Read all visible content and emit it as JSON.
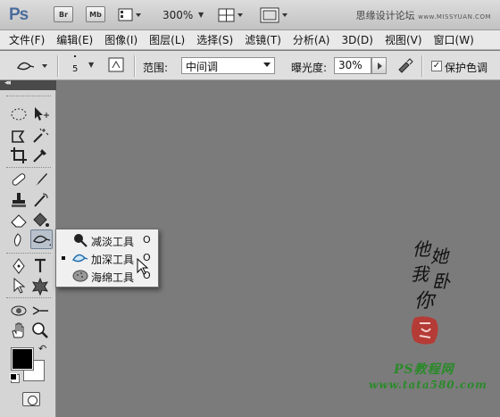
{
  "app": {
    "logo": "Ps",
    "bridge_label": "Br",
    "minibridge_label": "Mb",
    "zoom": "300%",
    "top_watermark": "思缘设计论坛",
    "top_watermark_url": "www.MISSYUAN.COM"
  },
  "menu": {
    "items": [
      "文件(F)",
      "编辑(E)",
      "图像(I)",
      "图层(L)",
      "选择(S)",
      "滤镜(T)",
      "分析(A)",
      "3D(D)",
      "视图(V)",
      "窗口(W)"
    ]
  },
  "options": {
    "brush_size": "5",
    "range_label": "范围:",
    "range_value": "中间调",
    "exposure_label": "曝光度:",
    "exposure_value": "30%",
    "protect_tones_label": "保护色调",
    "protect_tones_checked": true
  },
  "toolbar": {
    "collapse_glyph": "◂◂",
    "swap_glyph": "↶"
  },
  "flyout": {
    "items": [
      {
        "label": "减淡工具",
        "shortcut": "O",
        "icon": "dodge-icon",
        "active": false
      },
      {
        "label": "加深工具",
        "shortcut": "O",
        "icon": "burn-icon",
        "active": true
      },
      {
        "label": "海绵工具",
        "shortcut": "O",
        "icon": "sponge-icon",
        "active": false
      }
    ]
  },
  "watermark": {
    "calligraphy": [
      "他",
      "她",
      "我",
      "卧",
      "你"
    ],
    "seal_text": "印",
    "site_name": "PS教程网",
    "site_url": "www.tata580.com"
  },
  "colors": {
    "canvas": "#7b7b7b",
    "foreground": "#000000",
    "background": "#ffffff",
    "watermark_green": "#2a8a2a",
    "seal_red": "#c0302a"
  }
}
